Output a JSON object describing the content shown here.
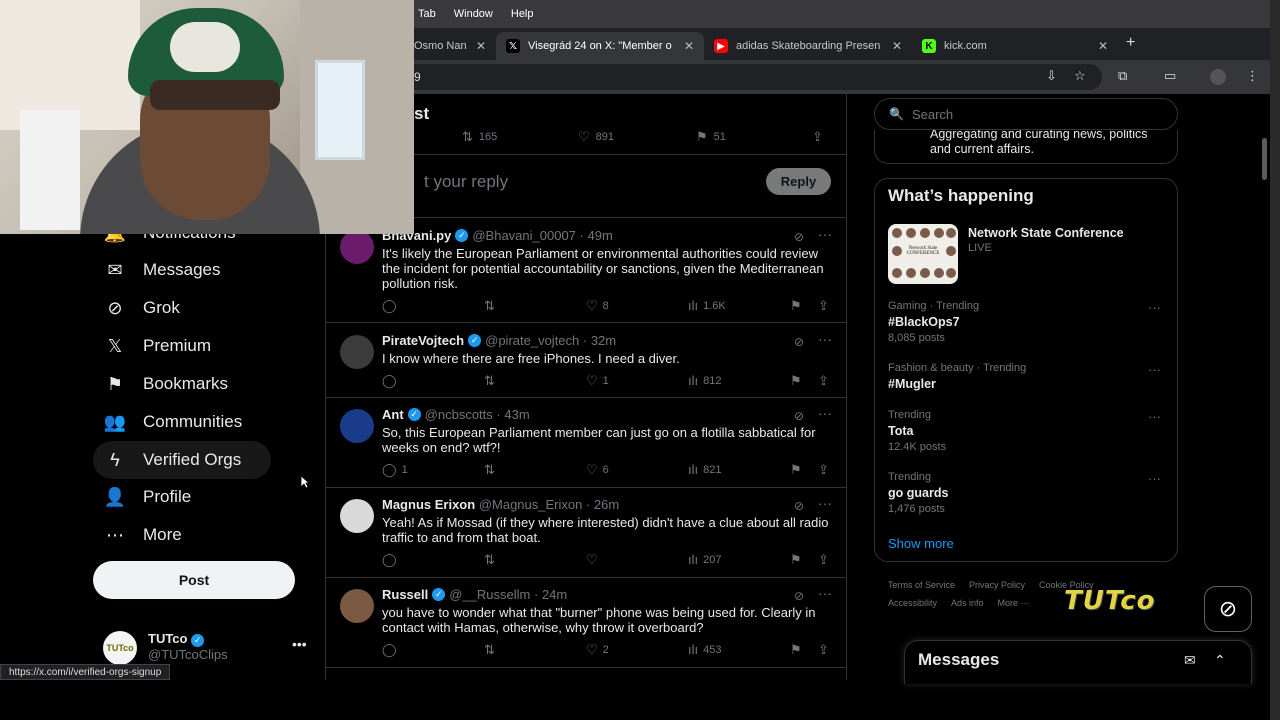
{
  "mac_menu": [
    "Tab",
    "Window",
    "Help"
  ],
  "tabs": [
    {
      "title": "Osmo Nan",
      "favicon": "",
      "color": "#888888",
      "active": false
    },
    {
      "title": "Visegrád 24 on X: \"Member o",
      "favicon": "X",
      "color": "#000000",
      "active": true
    },
    {
      "title": "adidas Skateboarding Presen",
      "favicon": "▶",
      "color": "#ff0000",
      "active": false
    },
    {
      "title": "kick.com",
      "favicon": "K",
      "color": "#53fc18",
      "active": false
    }
  ],
  "address_bar": {
    "text": "9"
  },
  "nav": {
    "items": [
      {
        "label": "Notifications",
        "icon": "bell-icon",
        "glyph": "🔔"
      },
      {
        "label": "Messages",
        "icon": "envelope-icon",
        "glyph": "✉"
      },
      {
        "label": "Grok",
        "icon": "grok-icon",
        "glyph": "⊘"
      },
      {
        "label": "Premium",
        "icon": "x-logo-icon",
        "glyph": "𝕏"
      },
      {
        "label": "Bookmarks",
        "icon": "bookmark-icon",
        "glyph": "🔖"
      },
      {
        "label": "Communities",
        "icon": "communities-icon",
        "glyph": "👥"
      },
      {
        "label": "Verified Orgs",
        "icon": "lightning-icon",
        "glyph": "ϟ"
      },
      {
        "label": "Profile",
        "icon": "person-icon",
        "glyph": "👤"
      },
      {
        "label": "More",
        "icon": "more-circle-icon",
        "glyph": "⋯"
      }
    ],
    "post_label": "Post"
  },
  "account": {
    "name": "TUTco",
    "handle": "@TUTcoClips",
    "avatar_text": "TUTco"
  },
  "status_url": "https://x.com/i/verified-orgs-signup",
  "post_header": {
    "title": "st",
    "stats": {
      "reposts": "165",
      "likes": "891",
      "bookmarks": "51"
    }
  },
  "reply_box": {
    "placeholder": "t your reply",
    "button": "Reply"
  },
  "tweets": [
    {
      "name": "Bhavani.py",
      "handle": "@Bhavani_00007",
      "time": "· 49m",
      "text": "It's likely the European Parliament or environmental authorities could review the incident for potential accountability or sanctions, given the Mediterranean pollution risk.",
      "replies": "",
      "reposts": "",
      "likes": "8",
      "views": "1.6K",
      "avatar_color": "#6a1b6a"
    },
    {
      "name": "PirateVojtech",
      "handle": "@pirate_vojtech",
      "time": "· 32m",
      "text": "I know where there are free iPhones. I need a diver.",
      "replies": "",
      "reposts": "",
      "likes": "1",
      "views": "812",
      "avatar_color": "#3b3b3b"
    },
    {
      "name": "Ant",
      "handle": "@ncbscotts",
      "time": "· 43m",
      "text": "So, this European Parliament member can just go on a flotilla sabbatical for weeks on end?  wtf?!",
      "replies": "1",
      "reposts": "",
      "likes": "6",
      "views": "821",
      "avatar_color": "#1a3a8a"
    },
    {
      "name": "Magnus Erixon",
      "handle": "@Magnus_Erixon",
      "time": "· 26m",
      "text": "Yeah! As if Mossad (if they where interested) didn't have a clue about all radio traffic to and from that boat.",
      "replies": "",
      "reposts": "",
      "likes": "",
      "views": "207",
      "avatar_color": "#d9d9d9"
    },
    {
      "name": "Russell",
      "handle": "@__Russellm",
      "time": "· 24m",
      "text": "you have to wonder what that \"burner\" phone was being used for. Clearly in contact with Hamas, otherwise, why throw it overboard?",
      "replies": "",
      "reposts": "",
      "likes": "2",
      "views": "453",
      "avatar_color": "#7a5a40"
    }
  ],
  "sidebar": {
    "search_placeholder": "Search",
    "about_text": "Aggregating and curating news, politics and current affairs.",
    "whats_happening": "What’s happening",
    "featured": {
      "title": "Network State Conference",
      "subtitle": "LIVE",
      "image_text": "Network State CONFERENCE"
    },
    "trends": [
      {
        "context": "Gaming · Trending",
        "name": "#BlackOps7",
        "count": "8,085 posts"
      },
      {
        "context": "Fashion & beauty · Trending",
        "name": "#Mugler",
        "count": ""
      },
      {
        "context": "Trending",
        "name": "Tota",
        "count": "12.4K posts"
      },
      {
        "context": "Trending",
        "name": "go guards",
        "count": "1,476 posts"
      }
    ],
    "show_more": "Show more",
    "footer_row1": [
      "Terms of Service",
      "Privacy Policy",
      "Cookie Policy"
    ],
    "footer_row2": [
      "Accessibility",
      "Ads info",
      "More ···"
    ]
  },
  "watermark": "TUTco",
  "messages_drawer": {
    "title": "Messages"
  },
  "colors": {
    "accent": "#1d9bf0",
    "background": "#000000",
    "muted": "#71767b",
    "text": "#e7e9ea"
  }
}
